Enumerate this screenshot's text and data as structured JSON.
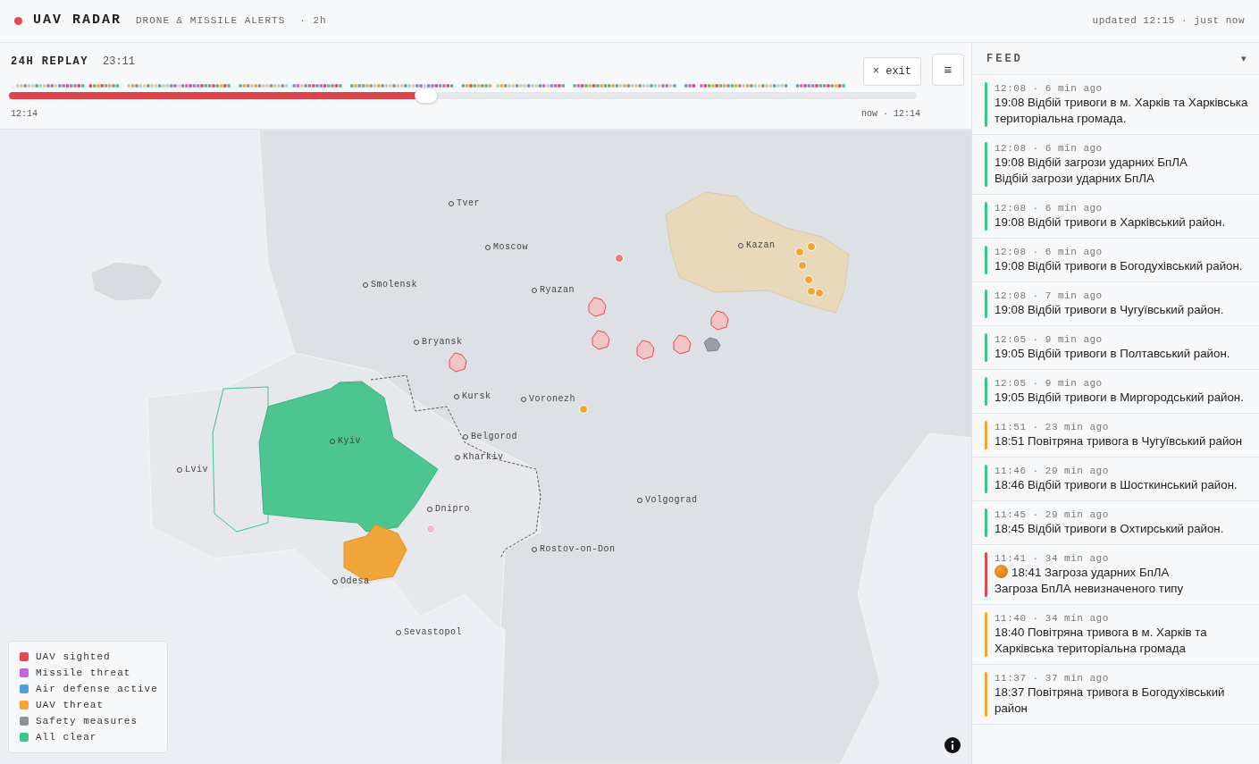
{
  "header": {
    "title": "UAV RADAR",
    "subtitle": "DRONE & MISSILE ALERTS",
    "range": "· 2h",
    "updated": "updated 12:15 · just now"
  },
  "replay": {
    "title": "24H REPLAY",
    "time": "23:11",
    "exit": "× exit",
    "menu": "≡",
    "level": 0.46,
    "start": "12:14",
    "end": "now · 12:14"
  },
  "map": {
    "cities": [
      {
        "name": "Tver"
      },
      {
        "name": "Moscow"
      },
      {
        "name": "Smolensk"
      },
      {
        "name": "Ryazan"
      },
      {
        "name": "Kazan"
      },
      {
        "name": "Bryansk"
      },
      {
        "name": "Kursk"
      },
      {
        "name": "Voronezh"
      },
      {
        "name": "Belgorod"
      },
      {
        "name": "Kharkiv"
      },
      {
        "name": "Kyiv"
      },
      {
        "name": "Lviv"
      },
      {
        "name": "Dnipro"
      },
      {
        "name": "Volgograd"
      },
      {
        "name": "Rostov-on-Don"
      },
      {
        "name": "Odesa"
      },
      {
        "name": "Sevastopol"
      }
    ]
  },
  "legend": [
    {
      "label": "UAV sighted",
      "color": "#e5484d"
    },
    {
      "label": "Missile threat",
      "color": "#c862d6"
    },
    {
      "label": "Air defense active",
      "color": "#4f9fe0"
    },
    {
      "label": "UAV threat",
      "color": "#f2a532"
    },
    {
      "label": "Safety measures",
      "color": "#8e9196"
    },
    {
      "label": "All clear",
      "color": "#3fc48c"
    }
  ],
  "feed": {
    "title": "FEED",
    "toggle": "▾",
    "items": [
      {
        "meta": "12:08 · 6 min ago",
        "text": "19:08 Відбій тривоги в м. Харків та Харківська територіальна громада.",
        "color": "#3fc48c"
      },
      {
        "meta": "12:08 · 6 min ago",
        "text": "19:08 Відбій загрози ударних БпЛА",
        "detail": "Відбій загрози ударних БпЛА",
        "color": "#3fc48c"
      },
      {
        "meta": "12:08 · 6 min ago",
        "text": "19:08 Відбій тривоги в Харківський район.",
        "color": "#3fc48c"
      },
      {
        "meta": "12:08 · 6 min ago",
        "text": "19:08 Відбій тривоги в Богодухівський район.",
        "color": "#3fc48c"
      },
      {
        "meta": "12:08 · 7 min ago",
        "text": "19:08 Відбій тривоги в Чугуївський район.",
        "color": "#3fc48c"
      },
      {
        "meta": "12:05 · 9 min ago",
        "text": "19:05 Відбій тривоги в Полтавський район.",
        "color": "#3fc48c"
      },
      {
        "meta": "12:05 · 9 min ago",
        "text": "19:05 Відбій тривоги в Миргородський район.",
        "color": "#3fc48c"
      },
      {
        "meta": "11:51 · 23 min ago",
        "text": "18:51 Повітряна тривога в Чугуївський район",
        "color": "#f2a532"
      },
      {
        "meta": "11:46 · 29 min ago",
        "text": "18:46 Відбій тривоги в Шосткинський район.",
        "color": "#3fc48c"
      },
      {
        "meta": "11:45 · 29 min ago",
        "text": "18:45 Відбій тривоги в Охтирський район.",
        "color": "#3fc48c"
      },
      {
        "meta": "11:41 · 34 min ago",
        "text": "18:41 Загроза ударних БпЛА",
        "detail": "Загроза БпЛА невизначеного типу",
        "color": "#e5484d",
        "icon": true
      },
      {
        "meta": "11:40 · 34 min ago",
        "text": "18:40 Повітряна тривога в м. Харків та Харківська територіальна громада",
        "color": "#f2a532"
      },
      {
        "meta": "11:37 · 37 min ago",
        "text": "18:37 Повітряна тривога в Богодухівський район",
        "color": "#f2a532"
      }
    ]
  }
}
